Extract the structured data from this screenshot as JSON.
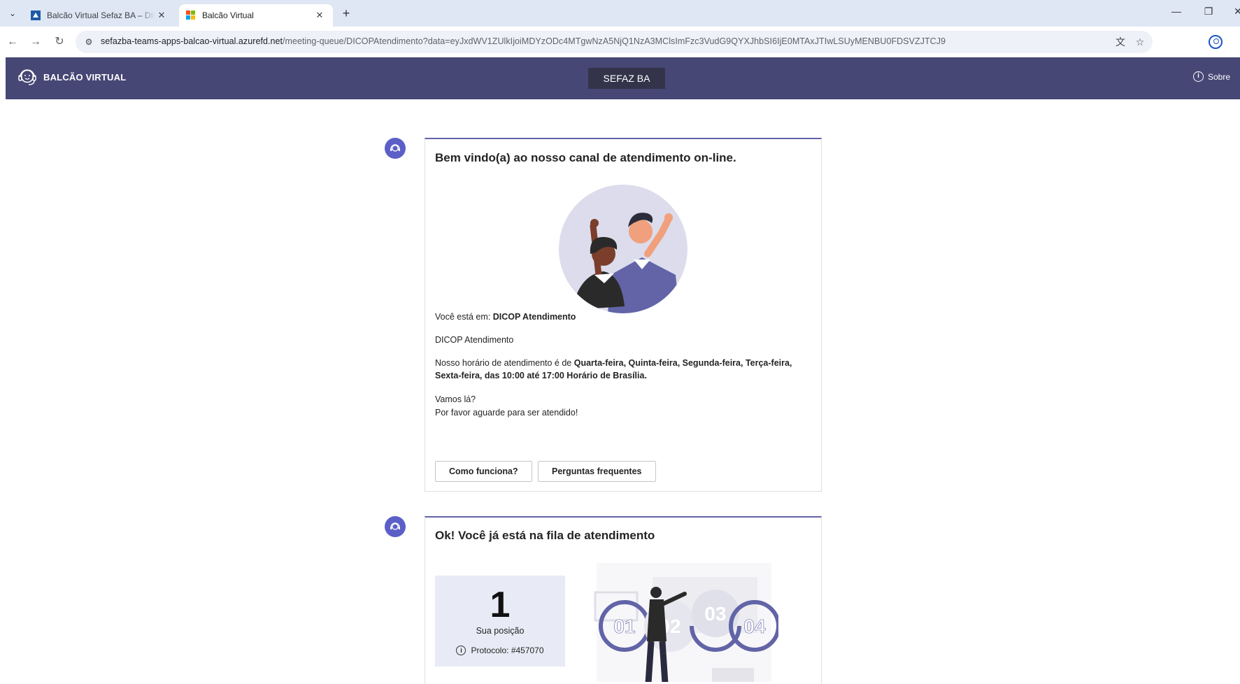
{
  "browser": {
    "tabs": [
      {
        "title": "Balcão Virtual Sefaz BA – DICOP Atendimento",
        "close": "✕"
      },
      {
        "title": "Balcão Virtual",
        "close": "✕"
      }
    ],
    "new_tab": "+",
    "url_host": "sefazba-teams-apps-balcao-virtual.azurefd.net",
    "url_path": "/meeting-queue/DICOPAtendimento?data=eyJxdWV1ZUlkIjoiMDYzODc4MTgwNzA5NjQ1NzA3MClsImFzc3VudG9QYXJhbSI6IjE0MTAxJTIwLSUyMENBU0FDSVZJTCJ9",
    "icons": [
      "tab-menu-icon",
      "back-icon",
      "forward-icon",
      "reload-icon",
      "site-info-icon",
      "translate-icon",
      "star-icon",
      "profile-icon",
      "minimize-icon",
      "restore-icon",
      "close-icon"
    ]
  },
  "header": {
    "brand": "BALCÃO VIRTUAL",
    "org": "SEFAZ BA",
    "about": "Sobre"
  },
  "welcome": {
    "title": "Bem vindo(a) ao nosso canal de atendimento on-line.",
    "location_prefix": "Você está em: ",
    "location_name": "DICOP Atendimento",
    "queue_name": "DICOP Atendimento",
    "hours_prefix": "Nosso horário de atendimento é de ",
    "hours_bold": "Quarta-feira, Quinta-feira, Segunda-feira, Terça-feira, Sexta-feira, das 10:00 até 17:00 Horário de Brasília.",
    "line1": "Vamos lá?",
    "line2": "Por favor aguarde para ser atendido!",
    "btn_how": "Como funciona?",
    "btn_faq": "Perguntas frequentes"
  },
  "queue": {
    "title": "Ok! Você já está na fila de atendimento",
    "position": "1",
    "position_label": "Sua posição",
    "protocol": "Protocolo: #457070",
    "illustration_numbers": [
      "01",
      "02",
      "03",
      "04"
    ]
  },
  "colors": {
    "brand": "#464775",
    "accent": "#6264a7",
    "avatar": "#5b5fc7",
    "queue_box": "#e8ebf5"
  }
}
